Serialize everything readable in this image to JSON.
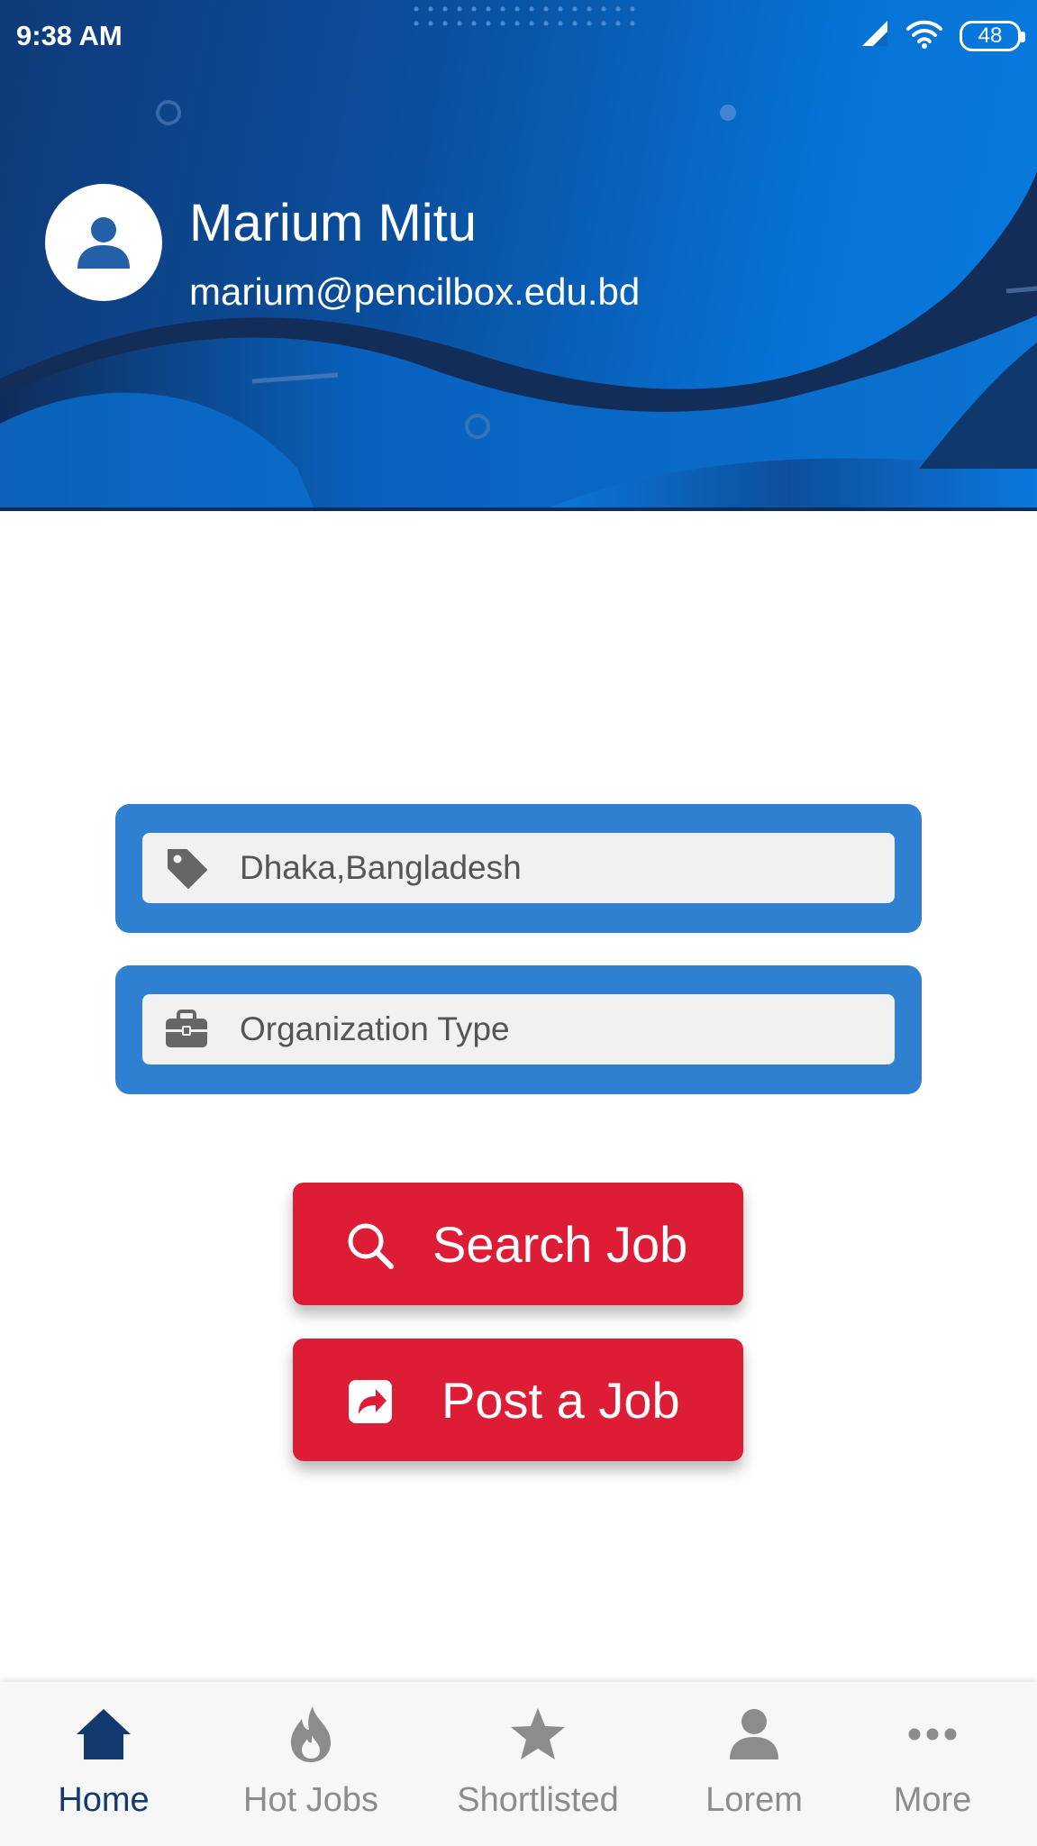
{
  "status_bar": {
    "time": "9:38 AM",
    "battery": "48"
  },
  "profile": {
    "name": "Marium Mitu",
    "email": "marium@pencilbox.edu.bd"
  },
  "form": {
    "location_value": "Dhaka,Bangladesh",
    "organization_placeholder": "Organization Type"
  },
  "buttons": {
    "search_label": "Search Job",
    "post_label": "Post a Job"
  },
  "bottom_nav": {
    "items": [
      {
        "label": "Home",
        "icon": "home-icon",
        "active": true
      },
      {
        "label": "Hot Jobs",
        "icon": "flame-icon",
        "active": false
      },
      {
        "label": "Shortlisted",
        "icon": "star-icon",
        "active": false
      },
      {
        "label": "Lorem",
        "icon": "person-icon",
        "active": false
      },
      {
        "label": "More",
        "icon": "more-dots-icon",
        "active": false
      }
    ]
  },
  "colors": {
    "header_dark": "#0f3a78",
    "header_light": "#0a7be0",
    "field_border": "#2f80d0",
    "button_red": "#dd1d36",
    "nav_active": "#133a6e",
    "nav_inactive": "#8c8c8c"
  }
}
